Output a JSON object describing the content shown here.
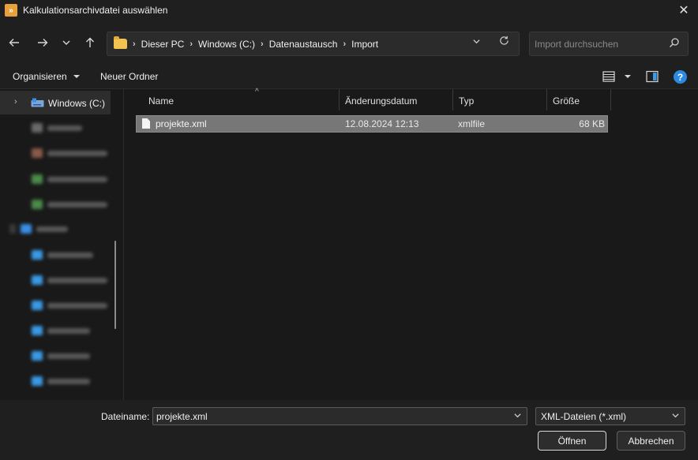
{
  "window": {
    "title": "Kalkulationsarchivdatei auswählen",
    "app_icon": "app-icon",
    "close_label": "✕"
  },
  "nav": {
    "back_icon": "arrow-left-icon",
    "forward_icon": "arrow-right-icon",
    "recent_icon": "chevron-down-icon",
    "up_icon": "arrow-up-icon",
    "breadcrumb": [
      "Dieser PC",
      "Windows (C:)",
      "Datenaustausch",
      "Import"
    ],
    "search_placeholder": "Import durchsuchen"
  },
  "toolbar": {
    "organize_label": "Organisieren",
    "new_folder_label": "Neuer Ordner",
    "view_icon": "list-view-icon",
    "preview_icon": "preview-pane-icon",
    "help_label": "?"
  },
  "sidebar": {
    "selected_label": "Windows (C:)"
  },
  "columns": {
    "name": "Name",
    "date": "Änderungsdatum",
    "type": "Typ",
    "size": "Größe"
  },
  "files": [
    {
      "name": "projekte.xml",
      "date": "12.08.2024 12:13",
      "type": "xmlfile",
      "size": "68 KB"
    }
  ],
  "bottom": {
    "filename_label": "Dateiname:",
    "filename_value": "projekte.xml",
    "filter_value": "XML-Dateien (*.xml)",
    "open_label": "Öffnen",
    "cancel_label": "Abbrechen"
  },
  "colors": {
    "background": "#191919",
    "panel": "#1f1f1f",
    "selection": "#777777",
    "accent": "#2c8ae0",
    "folder": "#f4c24e"
  }
}
